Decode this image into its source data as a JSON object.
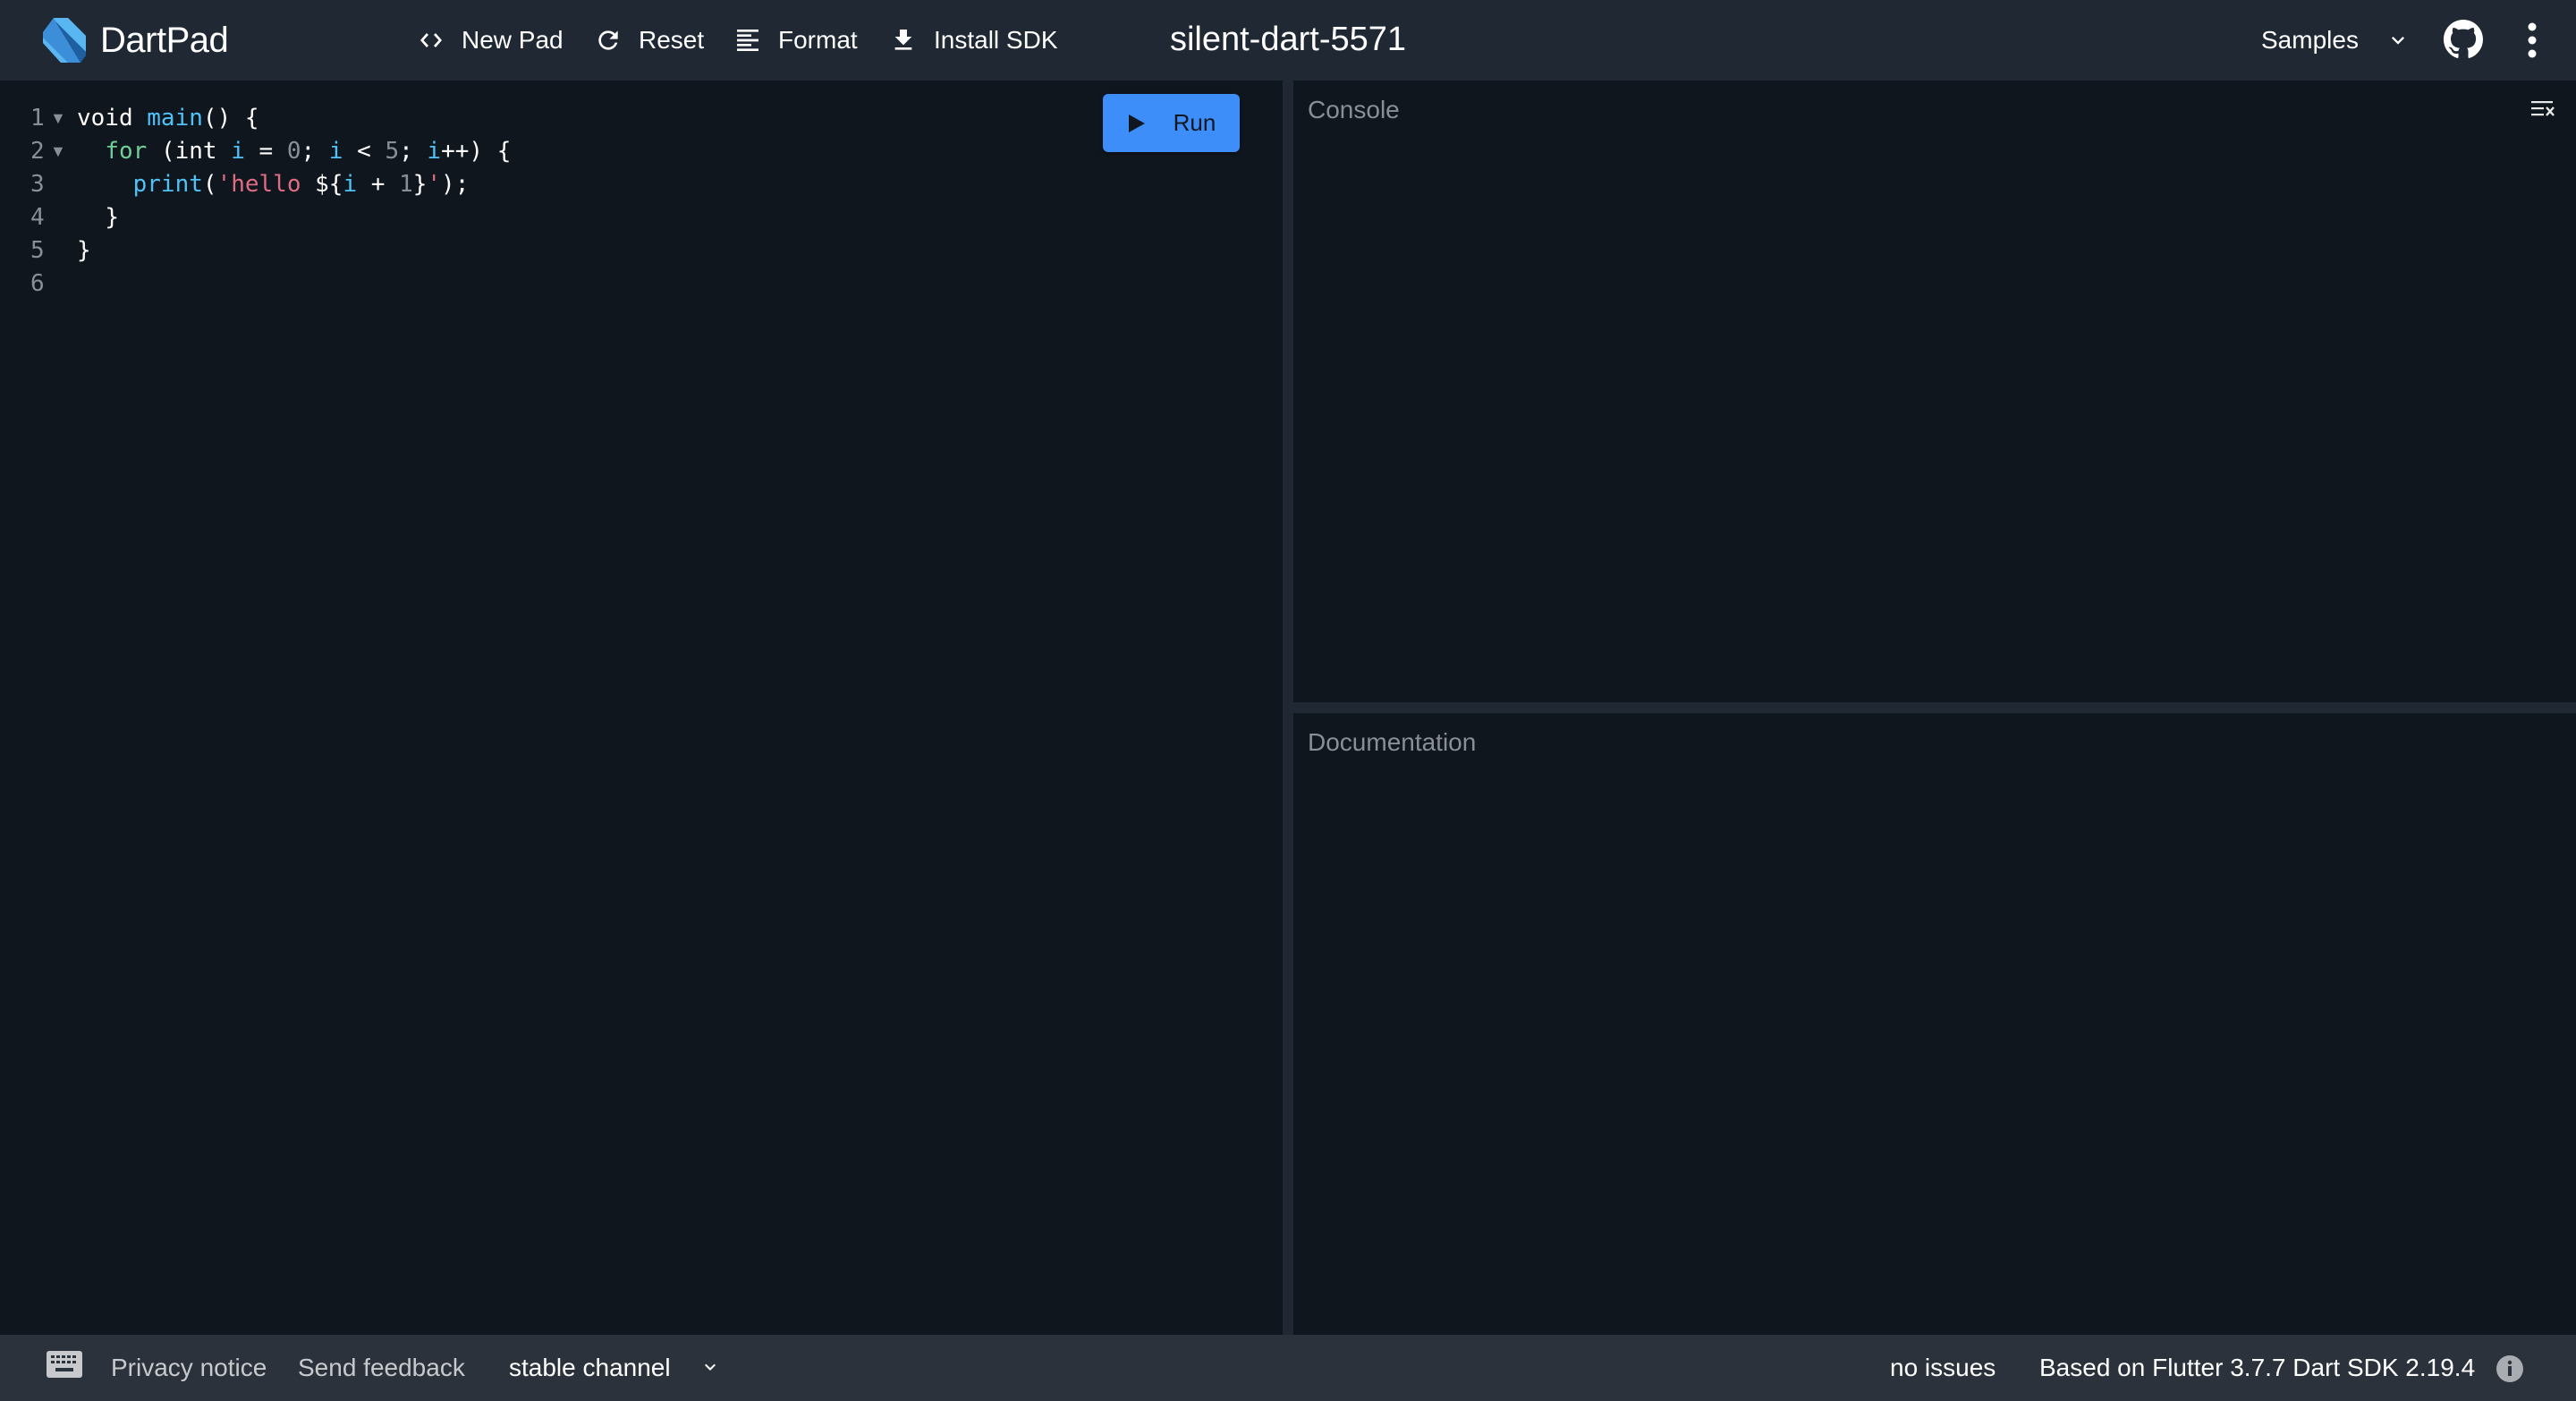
{
  "app": {
    "name": "DartPad",
    "pad_title": "silent-dart-5571"
  },
  "toolbar": {
    "new_pad": {
      "label": "New Pad",
      "icon": "code-brackets-icon"
    },
    "reset": {
      "label": "Reset",
      "icon": "refresh-icon"
    },
    "format": {
      "label": "Format",
      "icon": "align-left-icon"
    },
    "install_sdk": {
      "label": "Install SDK",
      "icon": "download-icon"
    },
    "samples": {
      "label": "Samples",
      "icon": "chevron-down-icon"
    },
    "github": {
      "icon": "github-icon"
    },
    "more": {
      "icon": "more-vert-icon"
    }
  },
  "editor": {
    "run_label": "Run",
    "line_numbers": [
      "1",
      "2",
      "3",
      "4",
      "5",
      "6"
    ],
    "foldable_lines": [
      1,
      2
    ],
    "code_lines": [
      "void main() {",
      "  for (int i = 0; i < 5; i++) {",
      "    print('hello ${i + 1}');",
      "  }",
      "}",
      ""
    ]
  },
  "console": {
    "title": "Console",
    "clear_icon": "clear-all-icon",
    "output": ""
  },
  "documentation": {
    "title": "Documentation",
    "content": ""
  },
  "footer": {
    "privacy": "Privacy notice",
    "feedback": "Send feedback",
    "channel": "stable channel",
    "issues": "no issues",
    "version": "Based on Flutter 3.7.7 Dart SDK 2.19.4"
  },
  "colors": {
    "header_bg": "#1f2833",
    "editor_bg": "#10161e",
    "footer_bg": "#2b323b",
    "run_button": "#3d8ef8",
    "keyword": "#6fcf97",
    "identifier": "#4fc3f7",
    "string": "#e06c84",
    "number": "#8a8f96"
  }
}
